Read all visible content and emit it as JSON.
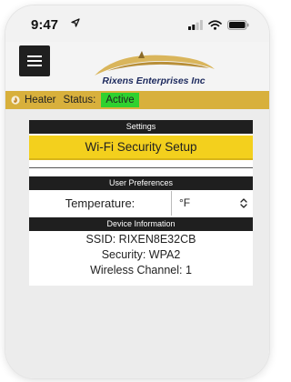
{
  "statusbar": {
    "time": "9:47"
  },
  "header": {
    "logo_text": "Rixens Enterprises Inc"
  },
  "heater_bar": {
    "heater_label": "Heater",
    "status_label": "Status:",
    "status_value": "Active"
  },
  "settings": {
    "heading": "Settings",
    "wifi_button": "Wi-Fi Security Setup"
  },
  "user_prefs": {
    "heading": "User Preferences",
    "temperature_label": "Temperature:",
    "temperature_unit": "°F"
  },
  "device_info": {
    "heading": "Device Information",
    "ssid": "SSID: RIXEN8E32CB",
    "security": "Security: WPA2",
    "channel": "Wireless Channel: 1"
  },
  "colors": {
    "accent_bar": "#d8b03c",
    "wifi_button": "#f3d01d",
    "active_badge": "#2fd12f",
    "section_header": "#1f1f1f"
  }
}
